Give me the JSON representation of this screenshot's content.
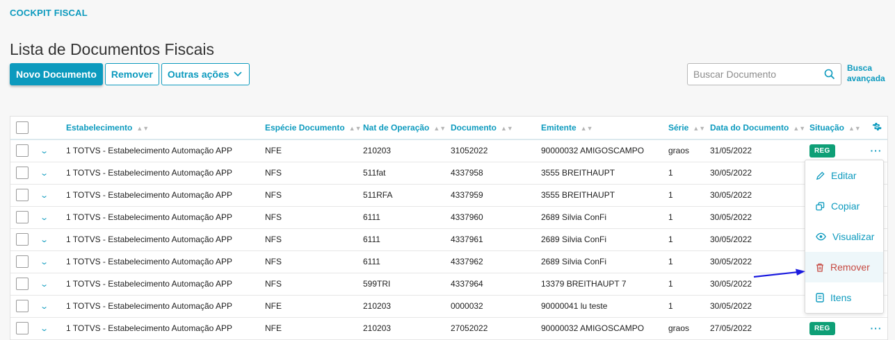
{
  "breadcrumb": "COCKPIT FISCAL",
  "page_title": "Lista de Documentos Fiscais",
  "actions": {
    "new_label": "Novo Documento",
    "remove_label": "Remover",
    "other_label": "Outras ações"
  },
  "search": {
    "placeholder": "Buscar Documento",
    "advanced_line1": "Busca",
    "advanced_line2": "avançada"
  },
  "table": {
    "headers": [
      "Estabelecimento",
      "Espécie Documento",
      "Nat de Operação",
      "Documento",
      "Emitente",
      "Série",
      "Data do Documento",
      "Situação"
    ],
    "rows": [
      {
        "estab": "1 TOTVS - Estabelecimento Automação APP",
        "especie": "NFE",
        "nat": "210203",
        "doc": "31052022",
        "emitente": "90000032 AMIGOSCAMPO",
        "serie": "graos",
        "data": "31/05/2022",
        "situacao": "REG"
      },
      {
        "estab": "1 TOTVS - Estabelecimento Automação APP",
        "especie": "NFS",
        "nat": "511fat",
        "doc": "4337958",
        "emitente": "3555 BREITHAUPT",
        "serie": "1",
        "data": "30/05/2022",
        "situacao": ""
      },
      {
        "estab": "1 TOTVS - Estabelecimento Automação APP",
        "especie": "NFS",
        "nat": "511RFA",
        "doc": "4337959",
        "emitente": "3555 BREITHAUPT",
        "serie": "1",
        "data": "30/05/2022",
        "situacao": ""
      },
      {
        "estab": "1 TOTVS - Estabelecimento Automação APP",
        "especie": "NFS",
        "nat": "6111",
        "doc": "4337960",
        "emitente": "2689 Silvia ConFi",
        "serie": "1",
        "data": "30/05/2022",
        "situacao": ""
      },
      {
        "estab": "1 TOTVS - Estabelecimento Automação APP",
        "especie": "NFS",
        "nat": "6111",
        "doc": "4337961",
        "emitente": "2689 Silvia ConFi",
        "serie": "1",
        "data": "30/05/2022",
        "situacao": ""
      },
      {
        "estab": "1 TOTVS - Estabelecimento Automação APP",
        "especie": "NFS",
        "nat": "6111",
        "doc": "4337962",
        "emitente": "2689 Silvia ConFi",
        "serie": "1",
        "data": "30/05/2022",
        "situacao": ""
      },
      {
        "estab": "1 TOTVS - Estabelecimento Automação APP",
        "especie": "NFS",
        "nat": "599TRI",
        "doc": "4337964",
        "emitente": "13379 BREITHAUPT 7",
        "serie": "1",
        "data": "30/05/2022",
        "situacao": ""
      },
      {
        "estab": "1 TOTVS - Estabelecimento Automação APP",
        "especie": "NFE",
        "nat": "210203",
        "doc": "0000032",
        "emitente": "90000041 lu teste",
        "serie": "1",
        "data": "30/05/2022",
        "situacao": ""
      },
      {
        "estab": "1 TOTVS - Estabelecimento Automação APP",
        "especie": "NFE",
        "nat": "210203",
        "doc": "27052022",
        "emitente": "90000032 AMIGOSCAMPO",
        "serie": "graos",
        "data": "27/05/2022",
        "situacao": "REG"
      }
    ]
  },
  "row_menu": {
    "items": [
      "Editar",
      "Copiar",
      "Visualizar",
      "Remover",
      "Itens"
    ]
  },
  "colors": {
    "accent": "#0c9abe",
    "status_reg": "#0e9f76",
    "danger": "#c64840",
    "annotation_arrow": "#1a1adf"
  },
  "icons": [
    "search-icon",
    "chevron-down-icon",
    "gear-icon",
    "more-icon",
    "pencil-icon",
    "copy-icon",
    "eye-icon",
    "trash-icon",
    "list-icon"
  ]
}
